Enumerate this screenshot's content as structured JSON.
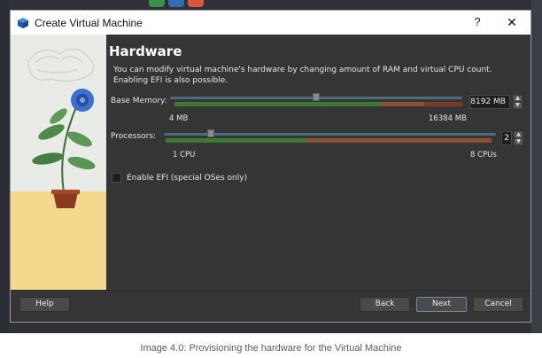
{
  "window": {
    "title": "Create Virtual Machine",
    "help_glyph": "?",
    "close_glyph": "✕"
  },
  "page": {
    "title": "Hardware",
    "description": "You can modify virtual machine's hardware by changing amount of RAM and virtual CPU count. Enabling EFI is also possible."
  },
  "memory": {
    "label": "Base Memory:",
    "value_text": "8192 MB",
    "min_label": "4 MB",
    "max_label": "16384 MB",
    "level_fraction": 0.5
  },
  "processors": {
    "label": "Processors:",
    "value_text": "2",
    "min_label": "1 CPU",
    "max_label": "8 CPUs",
    "level_fraction": 0.14
  },
  "efi": {
    "label": "Enable EFI (special OSes only)",
    "checked": false
  },
  "buttons": {
    "help": "Help",
    "back": "Back",
    "next": "Next",
    "cancel": "Cancel"
  },
  "caption": "Image 4.0: Provisioning the hardware for the Virtual Machine",
  "colors": {
    "content_bg": "#353535",
    "green_range": "#3f7a33",
    "red_range": "#7a3b24",
    "accent": "#4a6c80"
  }
}
